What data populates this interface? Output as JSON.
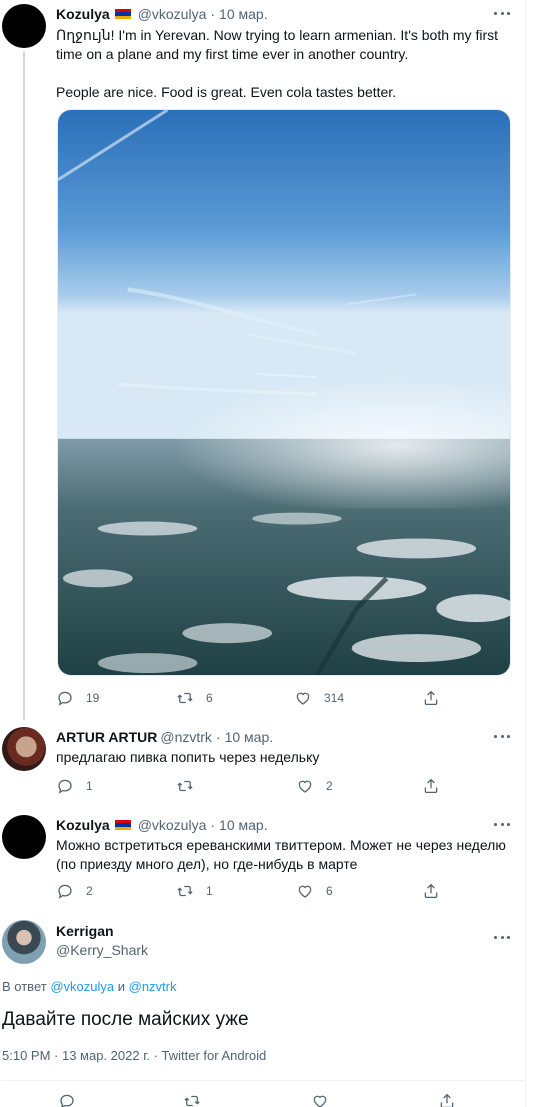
{
  "colors": {
    "text": "#0f1419",
    "secondary": "#536471",
    "link": "#1d9bf0",
    "armenia_flag": [
      "#d90012",
      "#0033a0",
      "#f2a800"
    ]
  },
  "tweets": [
    {
      "name": "Kozulya",
      "has_flag": true,
      "handle": "@vkozulya",
      "date": "10 мар.",
      "text": "Ողջույն! I'm in Yerevan. Now trying to learn armenian. It's both my first time on a plane and my first time ever in another country.\n\nPeople are nice. Food is great. Even cola tastes better.",
      "image_alt": "aerial view from airplane above snowy land and blue sky",
      "replies": "19",
      "retweets": "6",
      "likes": "314"
    },
    {
      "name": "ARTUR ARTUR",
      "has_flag": false,
      "handle": "@nzvtrk",
      "date": "10 мар.",
      "text": "предлагаю пивка попить через недельку",
      "replies": "1",
      "retweets": "",
      "likes": "2"
    },
    {
      "name": "Kozulya",
      "has_flag": true,
      "handle": "@vkozulya",
      "date": "10 мар.",
      "text": "Можно встретиться ереванскими твиттером. Может не через неделю (по приезду много дел), но где-нибудь в марте",
      "replies": "2",
      "retweets": "1",
      "likes": "6"
    }
  ],
  "main": {
    "name": "Kerrigan",
    "handle": "@Kerry_Shark",
    "reply_prefix": "В ответ",
    "reply_mention_1": "@vkozulya",
    "reply_conjunction": "и",
    "reply_mention_2": "@nzvtrk",
    "text": "Давайте после майских уже",
    "meta": "5:10 PM · 13 мар. 2022 г. · Twitter for Android"
  },
  "icons": [
    "reply-icon",
    "retweet-icon",
    "like-icon",
    "share-icon",
    "more-icon"
  ]
}
